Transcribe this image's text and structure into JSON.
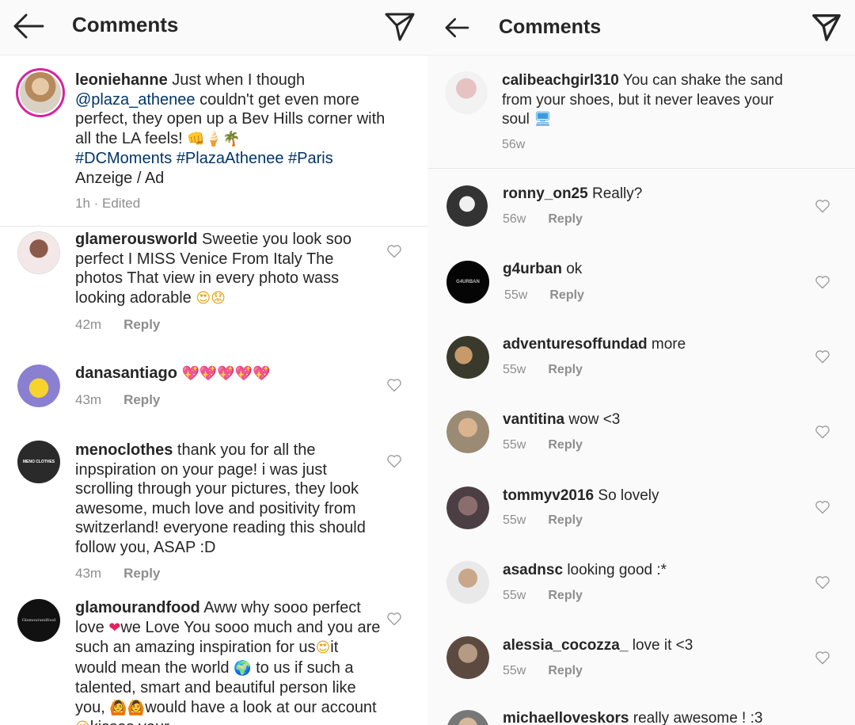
{
  "left": {
    "header": {
      "title": "Comments"
    },
    "caption": {
      "username": "leoniehanne",
      "text_1": "Just when I though",
      "mention": "@plaza_athenee",
      "text_2": "couldn't get even more perfect, they open up a Bev Hills corner with all the LA feels!",
      "emoji": "👊🍦🌴",
      "hashtags": "#DCMoments #PlazaAthenee #Paris",
      "ad_label": "Anzeige / Ad",
      "meta": "1h · Edited"
    },
    "comments": [
      {
        "username": "glamerousworld",
        "text": "Sweetie you look soo perfect I MISS Venice From Italy The photos That view in every photo wass looking adorable",
        "emoji": "😍😟",
        "time": "42m",
        "reply": "Reply"
      },
      {
        "username": "danasantiago",
        "text": "",
        "emoji": "💖💖💖💖💖",
        "time": "43m",
        "reply": "Reply"
      },
      {
        "username": "menoclothes",
        "text": "thank you for all the inpspiration on your page! i was just scrolling through your pictures, they look awesome, much love and positivity from switzerland! everyone reading this should follow you, ASAP :D",
        "emoji": "",
        "time": "43m",
        "reply": "Reply",
        "avatar_text": "MENO CLOTHES"
      },
      {
        "username": "glamourandfood",
        "text_1": "Aww why sooo perfect love",
        "emoji_1": "❤",
        "text_2": "we Love You sooo much and you are such an amazing inspiration for us",
        "emoji_2": "😍",
        "text_3": "it would mean the world",
        "emoji_3": "🌍",
        "text_4": "to us if such a talented, smart and beautiful person like you,",
        "emoji_4": "🙆🙆",
        "text_5": "would have a look at our account",
        "emoji_5": "😘",
        "text_6": "kisses your",
        "avatar_text": "Glamourandfood"
      }
    ]
  },
  "right": {
    "header": {
      "title": "Comments"
    },
    "caption": {
      "username": "calibeachgirl310",
      "text": "You can shake the sand from your shoes, but it never leaves your soul",
      "emoji": "🖥",
      "time": "56w"
    },
    "comments": [
      {
        "username": "ronny_on25",
        "text": "Really?",
        "time": "56w",
        "reply": "Reply"
      },
      {
        "username": "g4urban",
        "text": "ok",
        "time": "55w",
        "reply": "Reply",
        "avatar_text": "G4URBAN"
      },
      {
        "username": "adventuresoffundad",
        "text": "more",
        "time": "55w",
        "reply": "Reply"
      },
      {
        "username": "vantitina",
        "text": "wow <3",
        "time": "55w",
        "reply": "Reply"
      },
      {
        "username": "tommyv2016",
        "text": "So lovely",
        "time": "55w",
        "reply": "Reply"
      },
      {
        "username": "asadnsc",
        "text": "looking good :*",
        "time": "55w",
        "reply": "Reply"
      },
      {
        "username": "alessia_cocozza_",
        "text": "love it <3",
        "time": "55w",
        "reply": "Reply"
      },
      {
        "username": "michaelloveskors",
        "text": "really awesome ! :3"
      }
    ]
  },
  "colors": {
    "link": "#003569",
    "meta": "#8e8e8e",
    "text": "#262626",
    "ring": "#d6249f"
  },
  "icons": {
    "back": "arrow-left-icon",
    "send": "paper-plane-icon",
    "like": "heart-outline-icon"
  }
}
